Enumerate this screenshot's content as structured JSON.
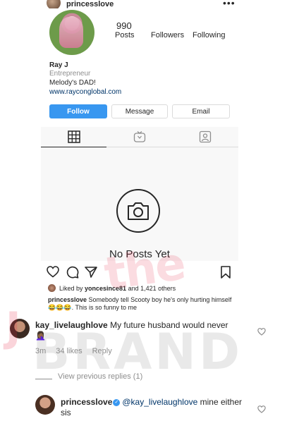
{
  "post_header": {
    "username": "princesslove",
    "more_icon": "more-icon"
  },
  "profile": {
    "posts_count": "990",
    "posts_label": "Posts",
    "followers_label": "Followers",
    "following_label": "Following",
    "name": "Ray J",
    "category": "Entrepreneur",
    "bio": "Melody's DAD!",
    "website": "www.rayconglobal.com",
    "buttons": {
      "follow": "Follow",
      "message": "Message",
      "email": "Email"
    },
    "tabs": [
      "grid-icon",
      "igtv-icon",
      "tagged-icon"
    ],
    "empty_state": "No Posts Yet"
  },
  "post": {
    "liked_by_prefix": "Liked by ",
    "liked_by_user": "yoncesince81",
    "liked_by_suffix": " and 1,421 others",
    "caption_user": "princesslove",
    "caption_text": " Somebody tell Scooty boy he's only hurting himself 😂😂😂. This is so funny to me"
  },
  "comments": [
    {
      "user": "kay_livelaughlove",
      "text": " My future husband would never 🤦🏾‍♀️",
      "time": "3m",
      "likes": "34 likes",
      "reply": "Reply"
    },
    {
      "user": "princesslove",
      "mention": "@kay_livelaughlove",
      "text": " mine either sis"
    }
  ],
  "view_replies": "View previous replies (1)",
  "watermark": {
    "the": "the",
    "j": "J",
    "brand": "BRAND"
  },
  "colors": {
    "follow_button": "#3897f0",
    "link": "#003569",
    "muted": "#8e8e8e",
    "watermark_red": "#e62846"
  }
}
